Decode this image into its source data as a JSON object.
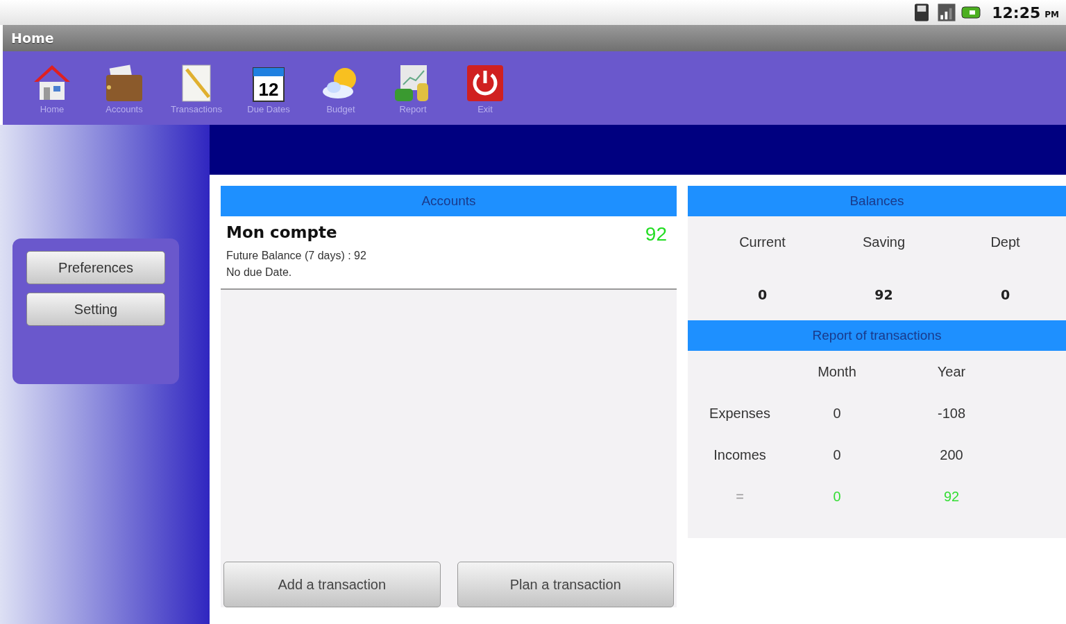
{
  "status_bar": {
    "time": "12:25",
    "ampm": "PM"
  },
  "title_bar": {
    "title": "Home"
  },
  "toolbar": [
    {
      "label": "Home"
    },
    {
      "label": "Accounts"
    },
    {
      "label": "Transactions"
    },
    {
      "label": "Due Dates",
      "icon_text": "12"
    },
    {
      "label": "Budget"
    },
    {
      "label": "Report"
    },
    {
      "label": "Exit"
    }
  ],
  "sidebar": {
    "buttons": [
      "Preferences",
      "Setting"
    ]
  },
  "accounts": {
    "title": "Accounts",
    "items": [
      {
        "name": "Mon compte",
        "amount": "92",
        "future": "Future Balance (7 days) : 92",
        "due": "No due Date."
      }
    ],
    "buttons": [
      "Add a transaction",
      "Plan a transaction"
    ]
  },
  "balances": {
    "title": "Balances",
    "columns": [
      "Current",
      "Saving",
      "Dept"
    ],
    "values": [
      "0",
      "92",
      "0"
    ]
  },
  "report": {
    "title": "Report of transactions",
    "columns": [
      "Month",
      "Year"
    ],
    "rows": [
      {
        "kind": "plain",
        "label": "Expenses",
        "values": [
          "0",
          "-108"
        ]
      },
      {
        "kind": "plain",
        "label": "Incomes",
        "values": [
          "0",
          "200"
        ]
      },
      {
        "kind": "total",
        "label": "=",
        "values": [
          "0",
          "92"
        ]
      }
    ]
  }
}
